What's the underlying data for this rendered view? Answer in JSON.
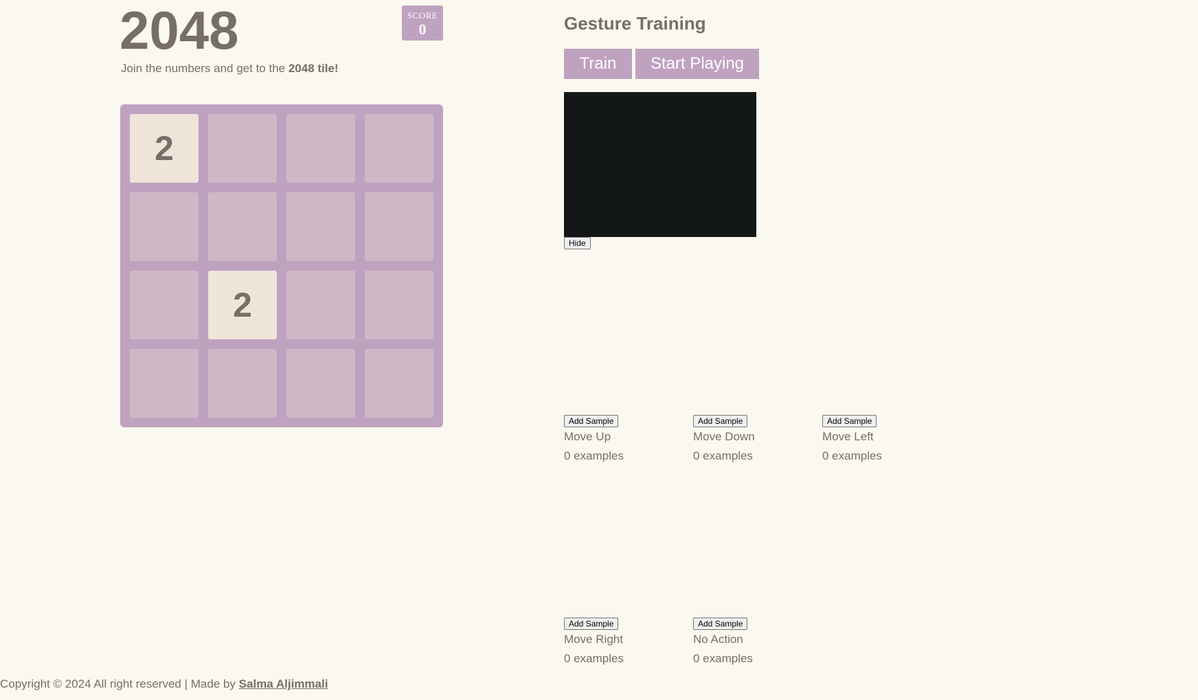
{
  "game": {
    "title": "2048",
    "score_label": "SCORE",
    "score_value": "0",
    "intro_prefix": "Join the numbers and get to the ",
    "intro_bold": "2048 tile!",
    "board": [
      [
        "2",
        "",
        "",
        ""
      ],
      [
        "",
        "",
        "",
        ""
      ],
      [
        "",
        "2",
        "",
        ""
      ],
      [
        "",
        "",
        "",
        ""
      ]
    ]
  },
  "footer": {
    "copyright": "Copyright © 2024 All right reserved | Made by ",
    "author": "Salma Aljimmali"
  },
  "training": {
    "title": "Gesture Training",
    "train_label": "Train",
    "play_label": "Start Playing",
    "hide_label": "Hide",
    "gestures": [
      {
        "button": "Add Sample",
        "name": "Move Up",
        "count": "0 examples"
      },
      {
        "button": "Add Sample",
        "name": "Move Down",
        "count": "0 examples"
      },
      {
        "button": "Add Sample",
        "name": "Move Left",
        "count": "0 examples"
      },
      {
        "button": "Add Sample",
        "name": "Move Right",
        "count": "0 examples"
      },
      {
        "button": "Add Sample",
        "name": "No Action",
        "count": "0 examples"
      }
    ]
  },
  "colors": {
    "background": "#faf8ef",
    "text": "#776e65",
    "accent": "#bfa2bf",
    "empty_cell": "#cfb8c6",
    "tile_2": "#eee4da",
    "video": "#131817"
  }
}
